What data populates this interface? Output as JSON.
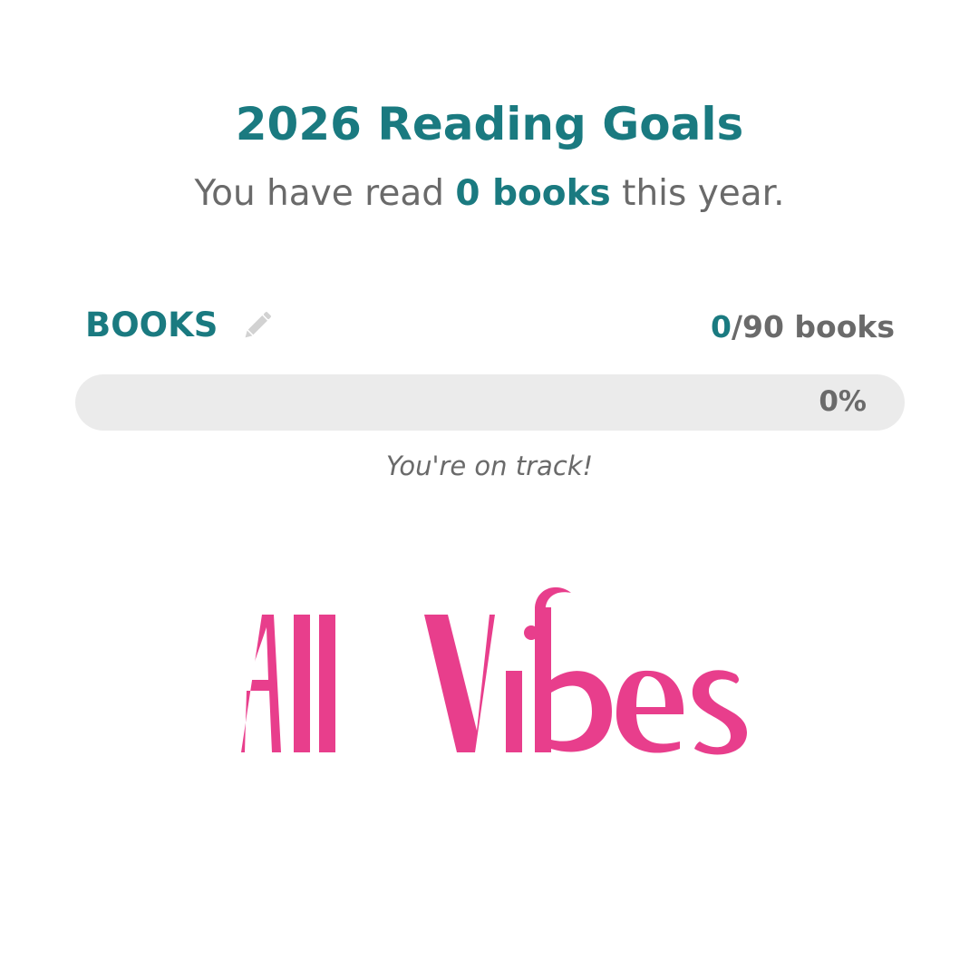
{
  "goals": {
    "title": "2026 Reading Goals",
    "summary_prefix": "You have read ",
    "summary_count": "0 books",
    "summary_suffix": " this year."
  },
  "books_goal": {
    "label": "BOOKS",
    "edit_icon": "pencil-icon",
    "read": "0",
    "target_text": "/90 books",
    "progress_fraction": 0,
    "progress_label": "0%",
    "status_text": "You're on track!"
  },
  "brand": {
    "logo_text": "All Vibes",
    "color": "#e83e8c"
  },
  "colors": {
    "accent": "#1a7a80",
    "muted_text": "#6a6a6a",
    "track": "#ebebeb"
  }
}
